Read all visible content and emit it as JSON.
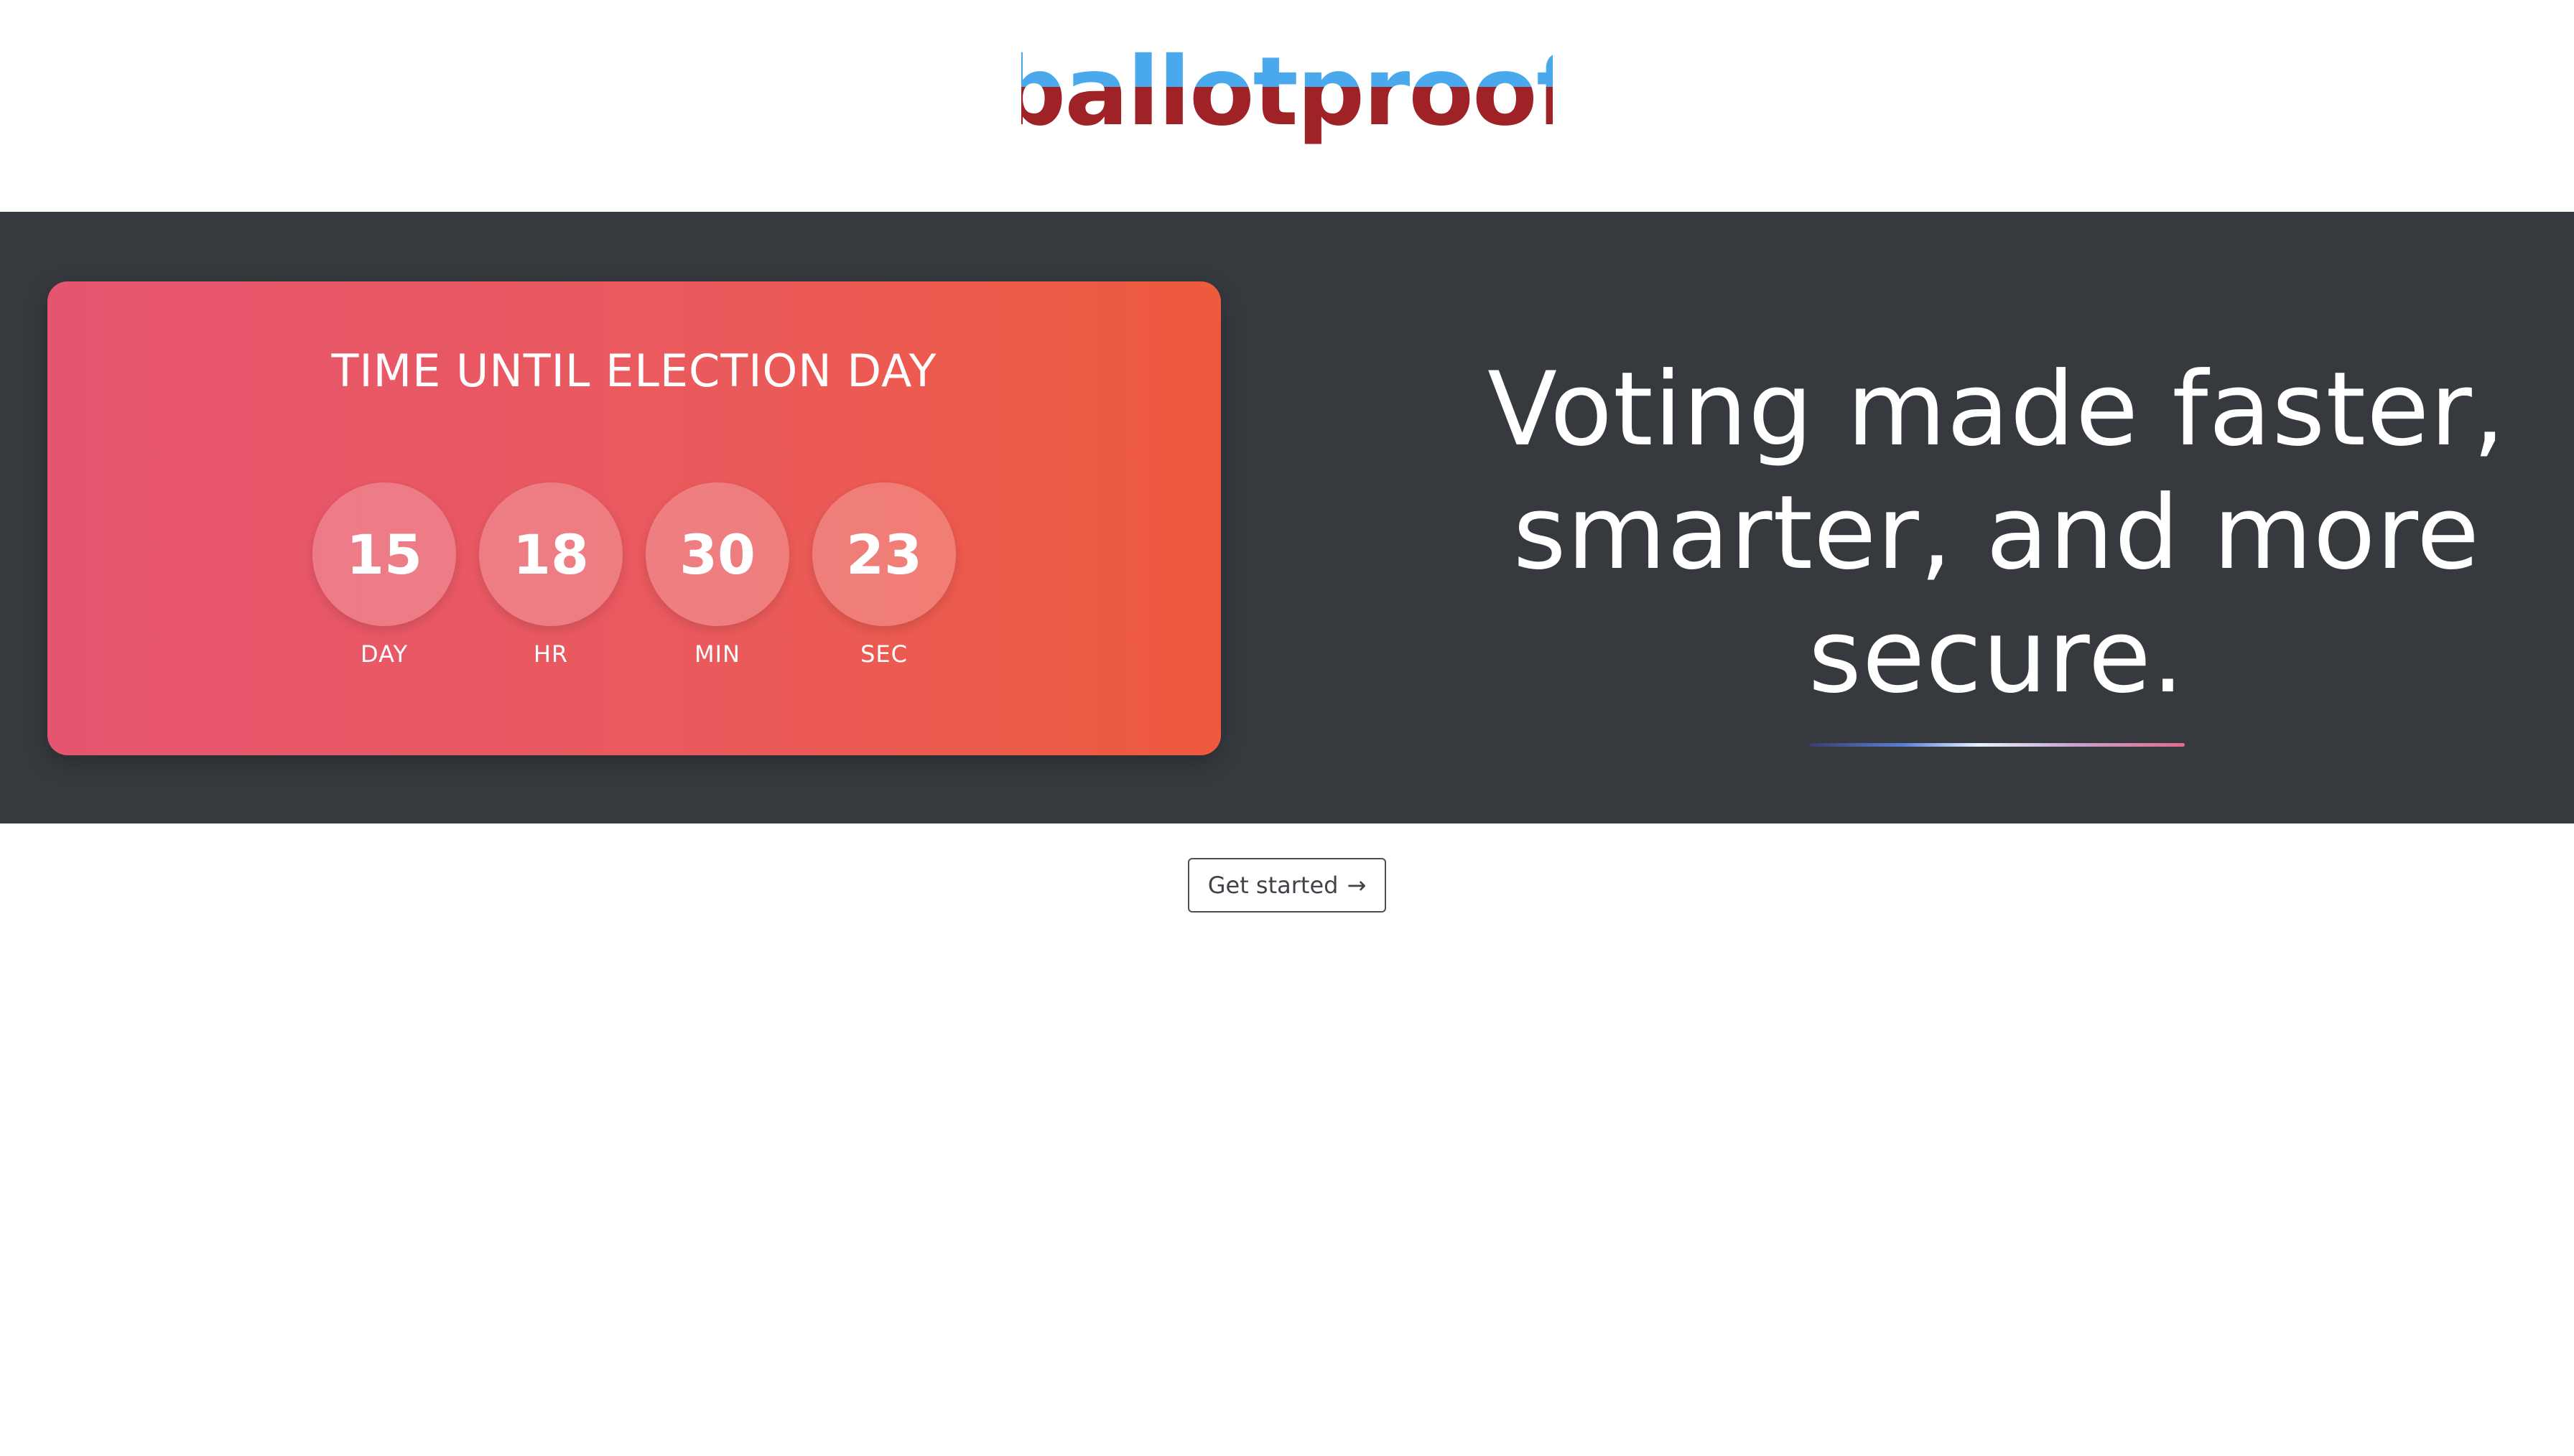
{
  "brand": {
    "logo_text": "ballotproof",
    "logo_top_color": "#4aa8ec",
    "logo_bottom_color": "#9e2226"
  },
  "countdown": {
    "title": "TIME UNTIL ELECTION DAY",
    "units": [
      {
        "value": "15",
        "label": "DAY"
      },
      {
        "value": "18",
        "label": "HR"
      },
      {
        "value": "30",
        "label": "MIN"
      },
      {
        "value": "23",
        "label": "SEC"
      }
    ],
    "gradient_start": "#e6556f",
    "gradient_end": "#ee5a3d"
  },
  "hero": {
    "background": "#363a3f",
    "headline_lines": [
      "Voting made faster,",
      "smarter, and more",
      "secure."
    ]
  },
  "cta": {
    "label": "Get started",
    "icon": "arrow-right-icon"
  }
}
